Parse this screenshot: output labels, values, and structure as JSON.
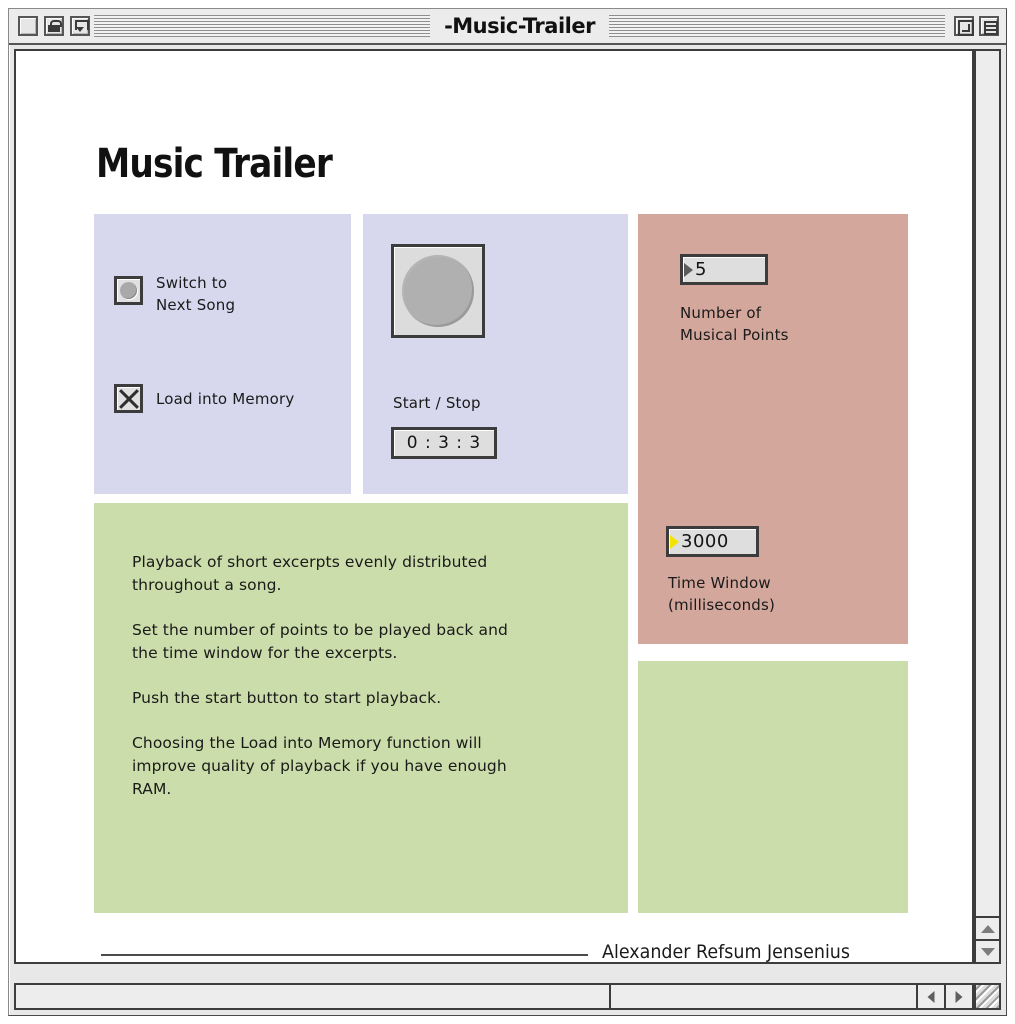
{
  "window": {
    "title": "-Music-Trailer",
    "buttons": {
      "close": "Close",
      "lock": "Lock",
      "collapse": "Collapse",
      "zoom": "Zoom",
      "windowshade": "Window Shade"
    }
  },
  "page": {
    "title": "Music Trailer",
    "signature": "Alexander Refsum Jensenius"
  },
  "controls": {
    "switch_label": "Switch to\nNext Song",
    "switch_label_line1": "Switch to",
    "switch_label_line2": "Next Song",
    "load_label": "Load into Memory"
  },
  "transport": {
    "start_stop_label": "Start / Stop",
    "time_value": "0 : 3 : 3"
  },
  "settings": {
    "points_value": "5",
    "points_label_line1": "Number of",
    "points_label_line2": "Musical Points",
    "window_value": "3000",
    "window_label_line1": "Time Window",
    "window_label_line2": "(milliseconds)"
  },
  "info": {
    "paragraphs": [
      "Playback of short excerpts evenly distributed throughout a song.",
      "Set the number of points to be played back and the time window for the excerpts.",
      "Push the start button to start playback.",
      "Choosing the Load into Memory function will improve quality of playback if you have enough RAM."
    ],
    "p0": "Playback of short excerpts evenly distributed throughout a song.",
    "p1": "Set the number of points to be played back and the time window for the excerpts.",
    "p2": "Push the start button to start playback.",
    "p3": "Choosing the Load into Memory function will improve quality of playback if you have enough RAM."
  },
  "colors": {
    "panel_lavender": "#d7d8ee",
    "panel_rose": "#d4a79d",
    "panel_green": "#cbddaa",
    "marker_selected": "#f3e400",
    "chrome": "#ededed"
  }
}
